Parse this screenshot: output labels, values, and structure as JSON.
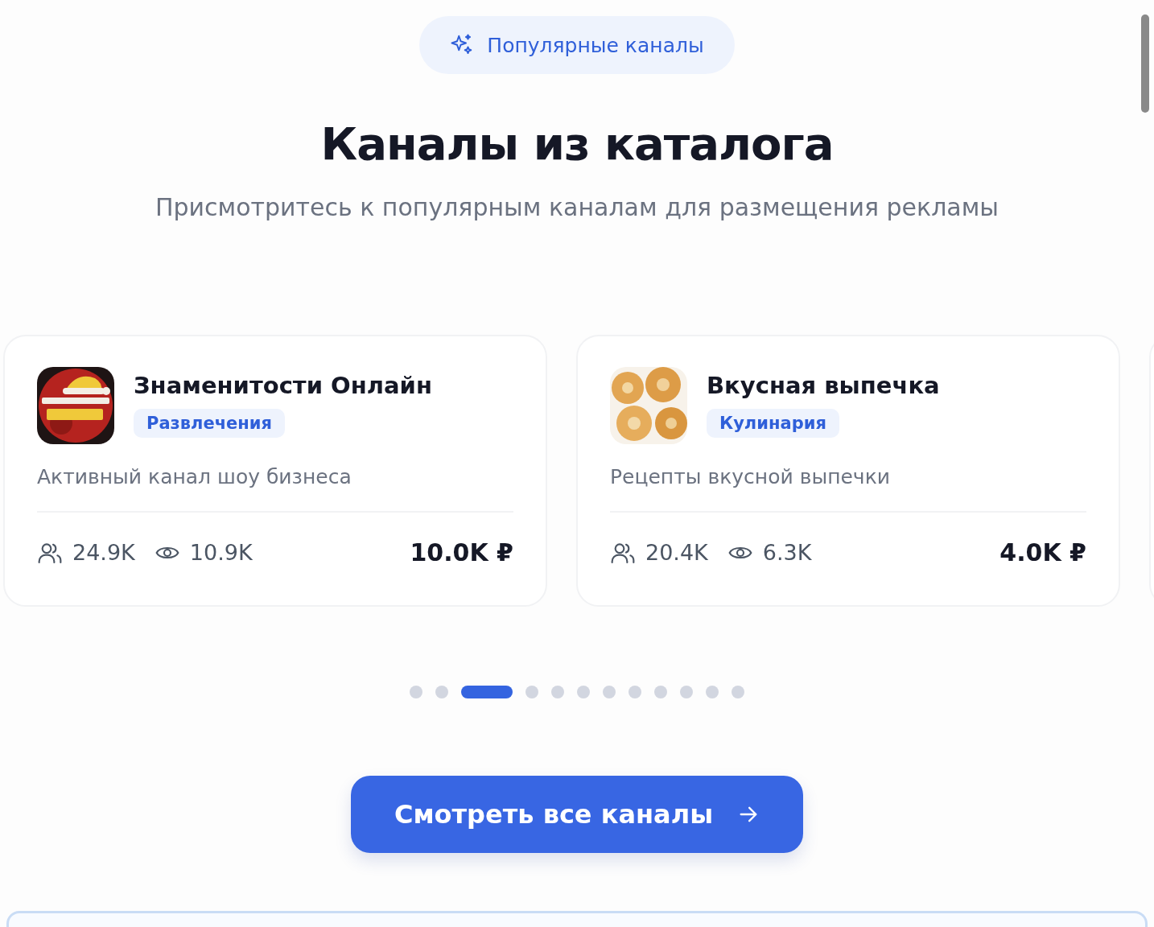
{
  "badge": {
    "label": "Популярные каналы"
  },
  "title": "Каналы из каталога",
  "subtitle": "Присмотритесь к популярным каналам для размещения рекламы",
  "channels": [
    {
      "name": "Знаменитости Онлайн",
      "category": "Развлечения",
      "description": "Активный канал шоу бизнеса",
      "subscribers": "24.9K",
      "views": "10.9K",
      "price": "10.0K ₽"
    },
    {
      "name": "Вкусная выпечка",
      "category": "Кулинария",
      "description": "Рецепты вкусной выпечки",
      "subscribers": "20.4K",
      "views": "6.3K",
      "price": "4.0K ₽"
    }
  ],
  "pagination": [
    {
      "selected": false
    },
    {
      "selected": false
    },
    {
      "selected": true
    },
    {
      "selected": false
    },
    {
      "selected": false
    },
    {
      "selected": false
    },
    {
      "selected": false
    },
    {
      "selected": false
    },
    {
      "selected": false
    },
    {
      "selected": false
    },
    {
      "selected": false
    },
    {
      "selected": false
    }
  ],
  "cta": {
    "label": "Смотреть все каналы"
  }
}
